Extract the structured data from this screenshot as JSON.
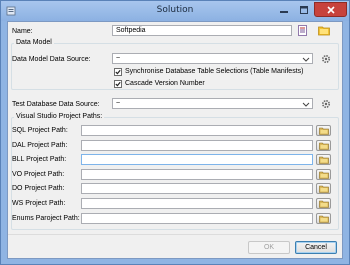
{
  "window": {
    "title": "Solution"
  },
  "name": {
    "label": "Name:",
    "value": "Softpedia"
  },
  "data_model": {
    "group_title": "Data Model",
    "source_label": "Data Model Data Source:",
    "source_value": "~",
    "sync_label": "Synchronise Database Table Selections (Table Manifests)",
    "sync_checked": true,
    "cascade_label": "Cascade Version Number",
    "cascade_checked": true
  },
  "test_db": {
    "label": "Test Database Data Source:",
    "value": "~"
  },
  "vs_paths": {
    "group_title": "Visual Studio Project Paths:",
    "rows": [
      {
        "label": "SQL Project Path:",
        "value": ""
      },
      {
        "label": "DAL Project Path:",
        "value": ""
      },
      {
        "label": "BLL Project Path:",
        "value": ""
      },
      {
        "label": "VO Project Path:",
        "value": ""
      },
      {
        "label": "DO Project Path:",
        "value": ""
      },
      {
        "label": "WS Project Path:",
        "value": ""
      },
      {
        "label": "Enums Paroject Path:",
        "value": ""
      }
    ]
  },
  "buttons": {
    "ok": "OK",
    "cancel": "Cancel"
  }
}
